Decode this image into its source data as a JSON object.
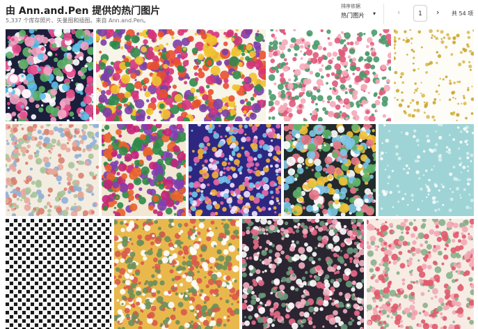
{
  "header": {
    "title": "由 Ann.and.Pen 提供的热门图片",
    "subtitle": "5,337 个库存照片、矢量图和插图。来自 Ann.and.Pen。",
    "sort_label": "排序依据",
    "sort_value": "热门图片",
    "page_current": "1",
    "page_total": "共 54 项"
  },
  "icons": {
    "prev": "chevron-left-icon",
    "next": "chevron-right-icon",
    "dropdown": "chevron-down-icon"
  },
  "images": [
    {
      "name": "dark-navy-flower-pattern",
      "bg": "#1b1f3b",
      "accents": [
        "#e84a8c",
        "#5bc0e8",
        "#f4a3c4",
        "#5fb36a",
        "#ffffff"
      ]
    },
    {
      "name": "colorful-folk-floral-pattern",
      "bg": "#f7f4e8",
      "accents": [
        "#7b3fa8",
        "#e8502f",
        "#2f8a4a",
        "#f2c230",
        "#d6337a"
      ]
    },
    {
      "name": "white-small-pink-flower-pattern",
      "bg": "#ffffff",
      "accents": [
        "#e05a7a",
        "#f5a9b8",
        "#4a9a6a"
      ]
    },
    {
      "name": "white-gold-dots-pattern",
      "bg": "#fdfcf7",
      "accents": [
        "#c9a227",
        "#d8b74a"
      ]
    },
    {
      "name": "beige-vintage-flower-pattern",
      "bg": "#f3ece1",
      "accents": [
        "#e7a89a",
        "#8fb0d8",
        "#a8c49a",
        "#d97f6f"
      ]
    },
    {
      "name": "cream-vivid-floral-pattern",
      "bg": "#f1e7d3",
      "accents": [
        "#c4237a",
        "#7f3fb0",
        "#e8632a",
        "#2d8a48"
      ]
    },
    {
      "name": "blue-purple-tiny-flower-pattern",
      "bg": "#2d2782",
      "accents": [
        "#e86aa8",
        "#f0e6ff",
        "#73c5e8",
        "#f3b23a"
      ]
    },
    {
      "name": "dark-bouquet-flower-pattern",
      "bg": "#232a2c",
      "accents": [
        "#f2c23a",
        "#e8788a",
        "#7fc7e8",
        "#ffffff",
        "#5fb36a"
      ]
    },
    {
      "name": "teal-snow-dots-pattern",
      "bg": "#9fd4d6",
      "accents": [
        "#ffffff",
        "#d8f0f0"
      ]
    },
    {
      "name": "houndstooth-pattern",
      "bg": "#f6f6f6",
      "accents": [
        "#1a1a1a"
      ]
    },
    {
      "name": "mustard-small-floral-pattern",
      "bg": "#e9b84c",
      "accents": [
        "#ffffff",
        "#d85a4a",
        "#6b8f5a"
      ]
    },
    {
      "name": "dark-white-blossom-pattern",
      "bg": "#2a2530",
      "accents": [
        "#ffffff",
        "#f3b0c0",
        "#e86a8a",
        "#6a9a7a"
      ]
    },
    {
      "name": "light-pink-flower-pattern",
      "bg": "#f6ece4",
      "accents": [
        "#e05a6a",
        "#f2a8b4",
        "#8ab08a"
      ]
    }
  ]
}
